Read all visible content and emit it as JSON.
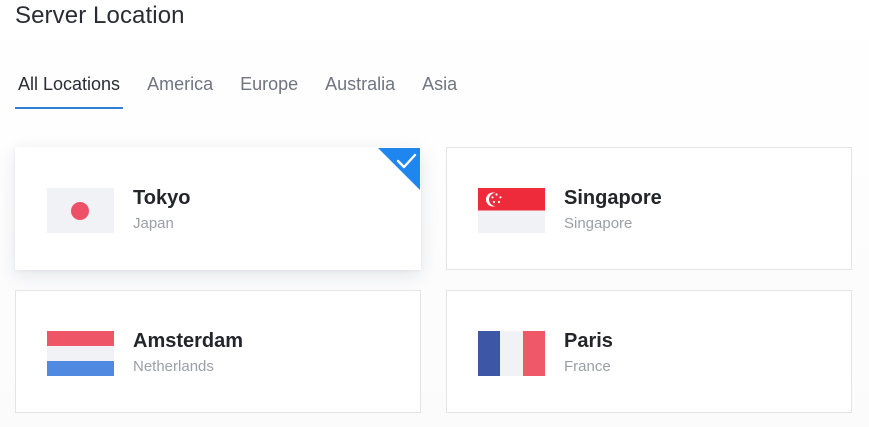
{
  "page": {
    "title": "Server Location"
  },
  "tabs": [
    {
      "label": "All Locations",
      "active": true
    },
    {
      "label": "America",
      "active": false
    },
    {
      "label": "Europe",
      "active": false
    },
    {
      "label": "Australia",
      "active": false
    },
    {
      "label": "Asia",
      "active": false
    }
  ],
  "colors": {
    "accent": "#2f7fd6",
    "selected_corner": "#1f86f0",
    "card_border": "#e3e4e8"
  },
  "locations": [
    {
      "city": "Tokyo",
      "country": "Japan",
      "flag_icon": "japan-flag-icon",
      "selected": true
    },
    {
      "city": "Singapore",
      "country": "Singapore",
      "flag_icon": "singapore-flag-icon",
      "selected": false
    },
    {
      "city": "Amsterdam",
      "country": "Netherlands",
      "flag_icon": "netherlands-flag-icon",
      "selected": false
    },
    {
      "city": "Paris",
      "country": "France",
      "flag_icon": "france-flag-icon",
      "selected": false
    }
  ]
}
